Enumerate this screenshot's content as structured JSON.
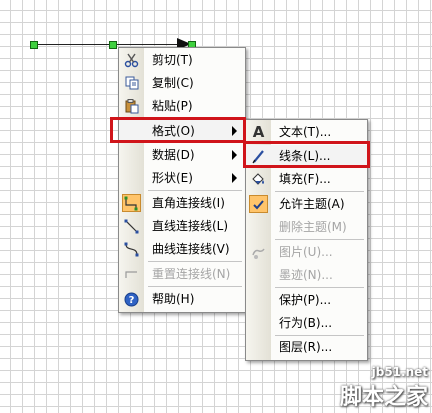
{
  "context_menu": {
    "items": [
      {
        "label": "剪切(T)",
        "icon": "scissors-icon"
      },
      {
        "label": "复制(C)",
        "icon": "copy-icon"
      },
      {
        "label": "粘贴(P)",
        "icon": "paste-icon"
      },
      {
        "label": "格式(O)",
        "icon": ""
      },
      {
        "label": "数据(D)",
        "icon": ""
      },
      {
        "label": "形状(E)",
        "icon": ""
      },
      {
        "label": "直角连接线(I)",
        "icon": "right-angle-connector-icon"
      },
      {
        "label": "直线连接线(L)",
        "icon": "straight-connector-icon"
      },
      {
        "label": "曲线连接线(V)",
        "icon": "curved-connector-icon"
      },
      {
        "label": "重置连接线(N)",
        "icon": "reset-connector-icon"
      },
      {
        "label": "帮助(H)",
        "icon": "help-icon"
      }
    ]
  },
  "format_submenu": {
    "items": [
      {
        "label": "文本(T)...",
        "icon": "text-A-icon"
      },
      {
        "label": "线条(L)...",
        "icon": "pen-icon"
      },
      {
        "label": "填充(F)...",
        "icon": "paint-bucket-icon"
      },
      {
        "label": "允许主题(A)",
        "icon": "check-icon"
      },
      {
        "label": "删除主题(M)",
        "icon": ""
      },
      {
        "label": "图片(U)...",
        "icon": "picture-icon"
      },
      {
        "label": "墨迹(N)...",
        "icon": ""
      },
      {
        "label": "保护(P)...",
        "icon": ""
      },
      {
        "label": "行为(B)...",
        "icon": ""
      },
      {
        "label": "图层(R)...",
        "icon": ""
      }
    ]
  },
  "watermark": {
    "top": "jb51.net",
    "bottom": "脚本之家"
  },
  "colors": {
    "highlight_border": "#d0141a",
    "handle": "#3fd03f",
    "grid": "#d4d4d4"
  }
}
